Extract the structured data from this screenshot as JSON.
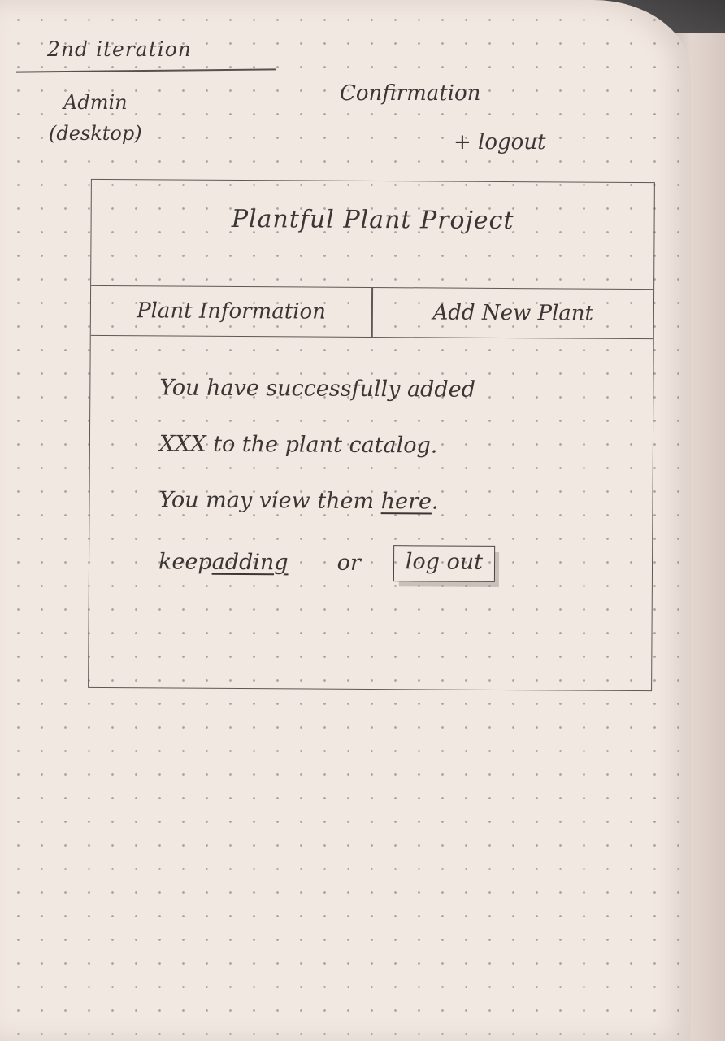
{
  "notes": {
    "iteration": "2nd iteration",
    "user_line1": "Admin",
    "user_line2": "(desktop)",
    "screen_line1": "Confirmation",
    "screen_line2": "+ logout"
  },
  "wireframe": {
    "site_title": "Plantful Plant Project",
    "nav": {
      "tab1": "Plant Information",
      "tab2": "Add New Plant"
    },
    "message": {
      "line1": "You have successfully added",
      "line2": "XXX to the plant catalog.",
      "line3_prefix": "You may view them ",
      "line3_link": "here",
      "line3_suffix": "."
    },
    "actions": {
      "keep_prefix": "keep ",
      "keep_link": "adding",
      "or": "or",
      "logout_button": "log out"
    }
  }
}
